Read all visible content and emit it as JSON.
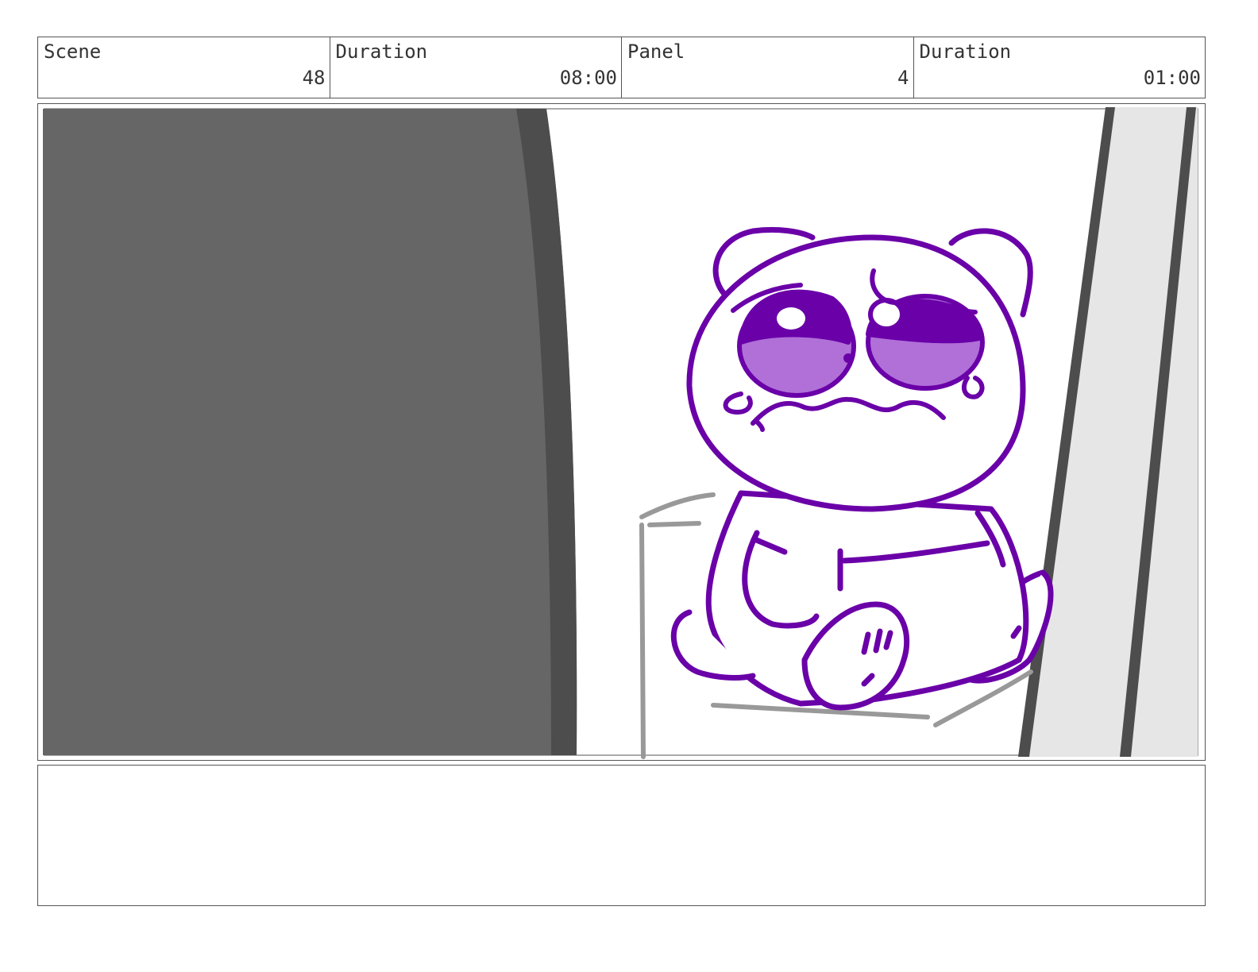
{
  "header": {
    "scene_label": "Scene",
    "scene_value": "48",
    "scene_duration_label": "Duration",
    "scene_duration_value": "08:00",
    "panel_label": "Panel",
    "panel_value": "4",
    "panel_duration_label": "Duration",
    "panel_duration_value": "01:00"
  },
  "artwork": {
    "subject": "crying-bear-icon",
    "line_color": "#6a00a8",
    "eye_fill": "#b070d8",
    "left_shadow": "#666666",
    "left_shadow_edge": "#4d4d4d",
    "right_wall": "#e6e6e6",
    "sketch_gray": "#999999"
  },
  "notes": {
    "text": ""
  }
}
